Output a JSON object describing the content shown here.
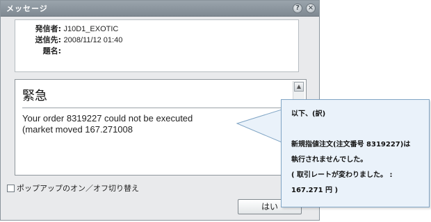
{
  "window": {
    "title": "メッセージ",
    "help_icon": "?",
    "close_icon": "×"
  },
  "header": {
    "sender_label": "発信者:",
    "sender_value": "J10D1_EXOTIC",
    "sent_label": "送信先:",
    "sent_value": "2008/11/12 01:40",
    "subject_label": "題名:",
    "subject_value": ""
  },
  "message": {
    "subject": "緊急",
    "body": "Your order 8319227 could not be executed\n(market moved 167.271008"
  },
  "popup_toggle_label": "ポップアップのオン／オフ切り替え",
  "yes_button_label": "はい",
  "translation": {
    "title": "以下、(訳)",
    "line1": "新規指値注文(注文番号 8319227)は",
    "line2": "執行されませんでした。",
    "line3": "( 取引レートが変わりました。 :",
    "line4": "167.271 円 )"
  },
  "colors": {
    "titlebar": "#8a949c",
    "callout_bg": "#eaf2fa",
    "callout_border": "#7fa4c4"
  }
}
